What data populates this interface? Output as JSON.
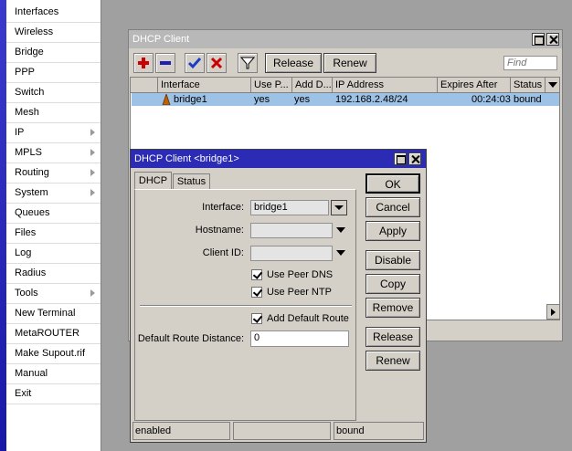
{
  "menu": {
    "items": [
      {
        "label": "Interfaces",
        "arrow": false
      },
      {
        "label": "Wireless",
        "arrow": false
      },
      {
        "label": "Bridge",
        "arrow": false
      },
      {
        "label": "PPP",
        "arrow": false
      },
      {
        "label": "Switch",
        "arrow": false
      },
      {
        "label": "Mesh",
        "arrow": false
      },
      {
        "label": "IP",
        "arrow": true
      },
      {
        "label": "MPLS",
        "arrow": true
      },
      {
        "label": "Routing",
        "arrow": true
      },
      {
        "label": "System",
        "arrow": true
      },
      {
        "label": "Queues",
        "arrow": false
      },
      {
        "label": "Files",
        "arrow": false
      },
      {
        "label": "Log",
        "arrow": false
      },
      {
        "label": "Radius",
        "arrow": false
      },
      {
        "label": "Tools",
        "arrow": true
      },
      {
        "label": "New Terminal",
        "arrow": false
      },
      {
        "label": "MetaROUTER",
        "arrow": false
      },
      {
        "label": "Make Supout.rif",
        "arrow": false
      },
      {
        "label": "Manual",
        "arrow": false
      },
      {
        "label": "Exit",
        "arrow": false
      }
    ]
  },
  "list_window": {
    "title": "DHCP Client",
    "toolbar": {
      "add_icon": "plus-icon",
      "remove_icon": "minus-icon",
      "enable_icon": "check-icon",
      "disable_icon": "cross-icon",
      "filter_icon": "filter-icon",
      "release_label": "Release",
      "renew_label": "Renew",
      "find_placeholder": "Find"
    },
    "columns": [
      "Interface",
      "Use P...",
      "Add D...",
      "IP Address",
      "Expires After",
      "Status"
    ],
    "rows": [
      {
        "interface": "bridge1",
        "use_peer": "yes",
        "add_default": "yes",
        "ip_address": "192.168.2.48/24",
        "expires_after": "00:24:03",
        "status": "bound"
      }
    ]
  },
  "dialog": {
    "title": "DHCP Client <bridge1>",
    "tabs": [
      "DHCP",
      "Status"
    ],
    "active_tab": "DHCP",
    "interface_label": "Interface:",
    "interface_value": "bridge1",
    "hostname_label": "Hostname:",
    "hostname_value": "",
    "client_id_label": "Client ID:",
    "client_id_value": "",
    "use_peer_dns_label": "Use Peer DNS",
    "use_peer_dns": true,
    "use_peer_ntp_label": "Use Peer NTP",
    "use_peer_ntp": true,
    "add_default_route_label": "Add Default Route",
    "add_default_route": true,
    "default_route_distance_label": "Default Route Distance:",
    "default_route_distance_value": "0",
    "buttons": {
      "ok": "OK",
      "cancel": "Cancel",
      "apply": "Apply",
      "disable": "Disable",
      "copy": "Copy",
      "remove": "Remove",
      "release": "Release",
      "renew": "Renew"
    },
    "status_left": "enabled",
    "status_mid": "",
    "status_right": "bound"
  },
  "colors": {
    "active_title": "#2b2bb6",
    "inactive_title": "#b8b8b8",
    "selected_row": "#9ec2e6",
    "add_red": "#cc0000",
    "remove_blue": "#2020b0",
    "check_blue": "#1c3cc8"
  }
}
